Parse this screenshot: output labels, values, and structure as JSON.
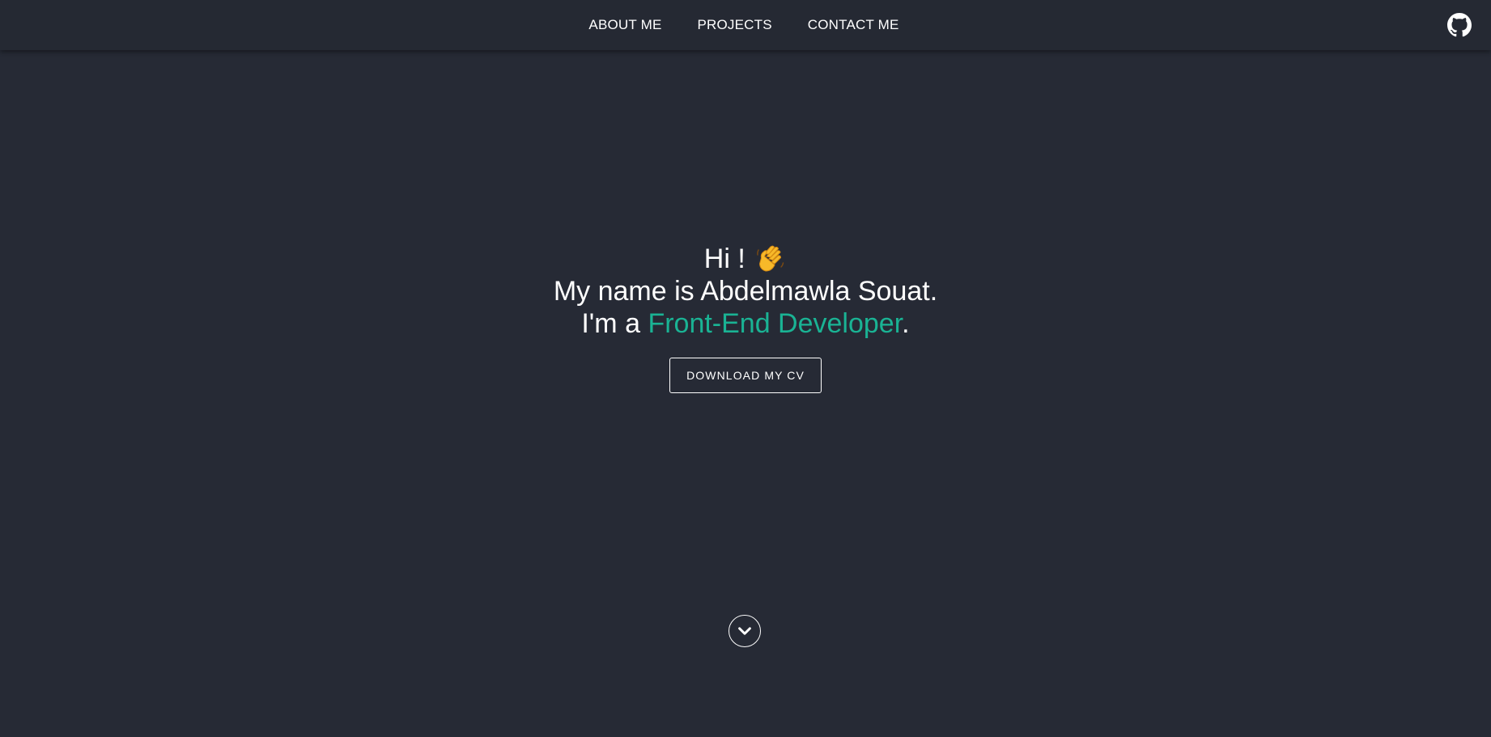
{
  "nav": {
    "items": [
      {
        "label": "ABOUT ME"
      },
      {
        "label": "PROJECTS"
      },
      {
        "label": "CONTACT ME"
      }
    ],
    "github_icon": "github-icon"
  },
  "hero": {
    "greeting": "Hi !",
    "wave_icon": "waving-hand-icon",
    "name_line": "My name is Abdelmawla Souat.",
    "role_prefix": "I'm a",
    "role": "Front-End Developer",
    "role_suffix": ".",
    "cta_label": "DOWNLOAD MY CV"
  },
  "scroll": {
    "icon": "chevron-down-icon"
  },
  "colors": {
    "background": "#262a35",
    "navbar": "#252933",
    "accent": "#1ab394",
    "text": "#ffffff"
  }
}
